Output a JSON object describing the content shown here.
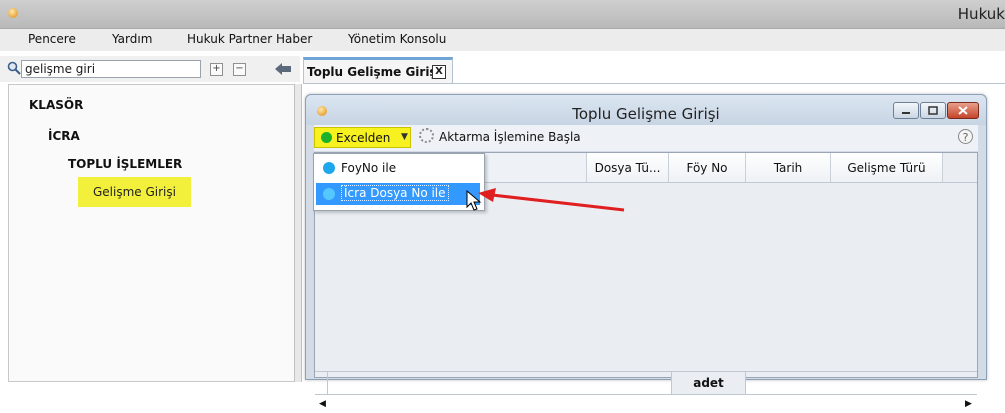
{
  "app": {
    "title": "Hukuk"
  },
  "menu": [
    "Pencere",
    "Yardım",
    "Hukuk Partner Haber",
    "Yönetim Konsolu"
  ],
  "left_panel": {
    "search": {
      "value": "gelişme giri"
    },
    "expand_label": "+",
    "collapse_label": "−",
    "tree": [
      {
        "label": "KLASÖR"
      },
      {
        "label": "İCRA"
      },
      {
        "label": "TOPLU İŞLEMLER"
      },
      {
        "label": "Gelişme Girişi",
        "highlighted": true
      }
    ]
  },
  "tab": {
    "label": "Toplu Gelişme Girişi",
    "close": "X"
  },
  "window": {
    "title": "Toplu Gelişme Girişi",
    "toolbar": {
      "excel_label": "Excelden",
      "transfer_label": "Aktarma İşlemine Başla",
      "help": "?"
    },
    "columns": [
      "Dosya Tü...",
      "Föy No",
      "Tarih",
      "Gelişme Türü"
    ],
    "footer": "adet",
    "dropdown": [
      {
        "label": "FoyNo ile",
        "selected": false
      },
      {
        "label": "İcra Dosya No ile",
        "selected": true
      }
    ]
  },
  "colors": {
    "highlight": "#f7f21f",
    "selection": "#3399ff",
    "annotation_arrow": "#e02020"
  }
}
